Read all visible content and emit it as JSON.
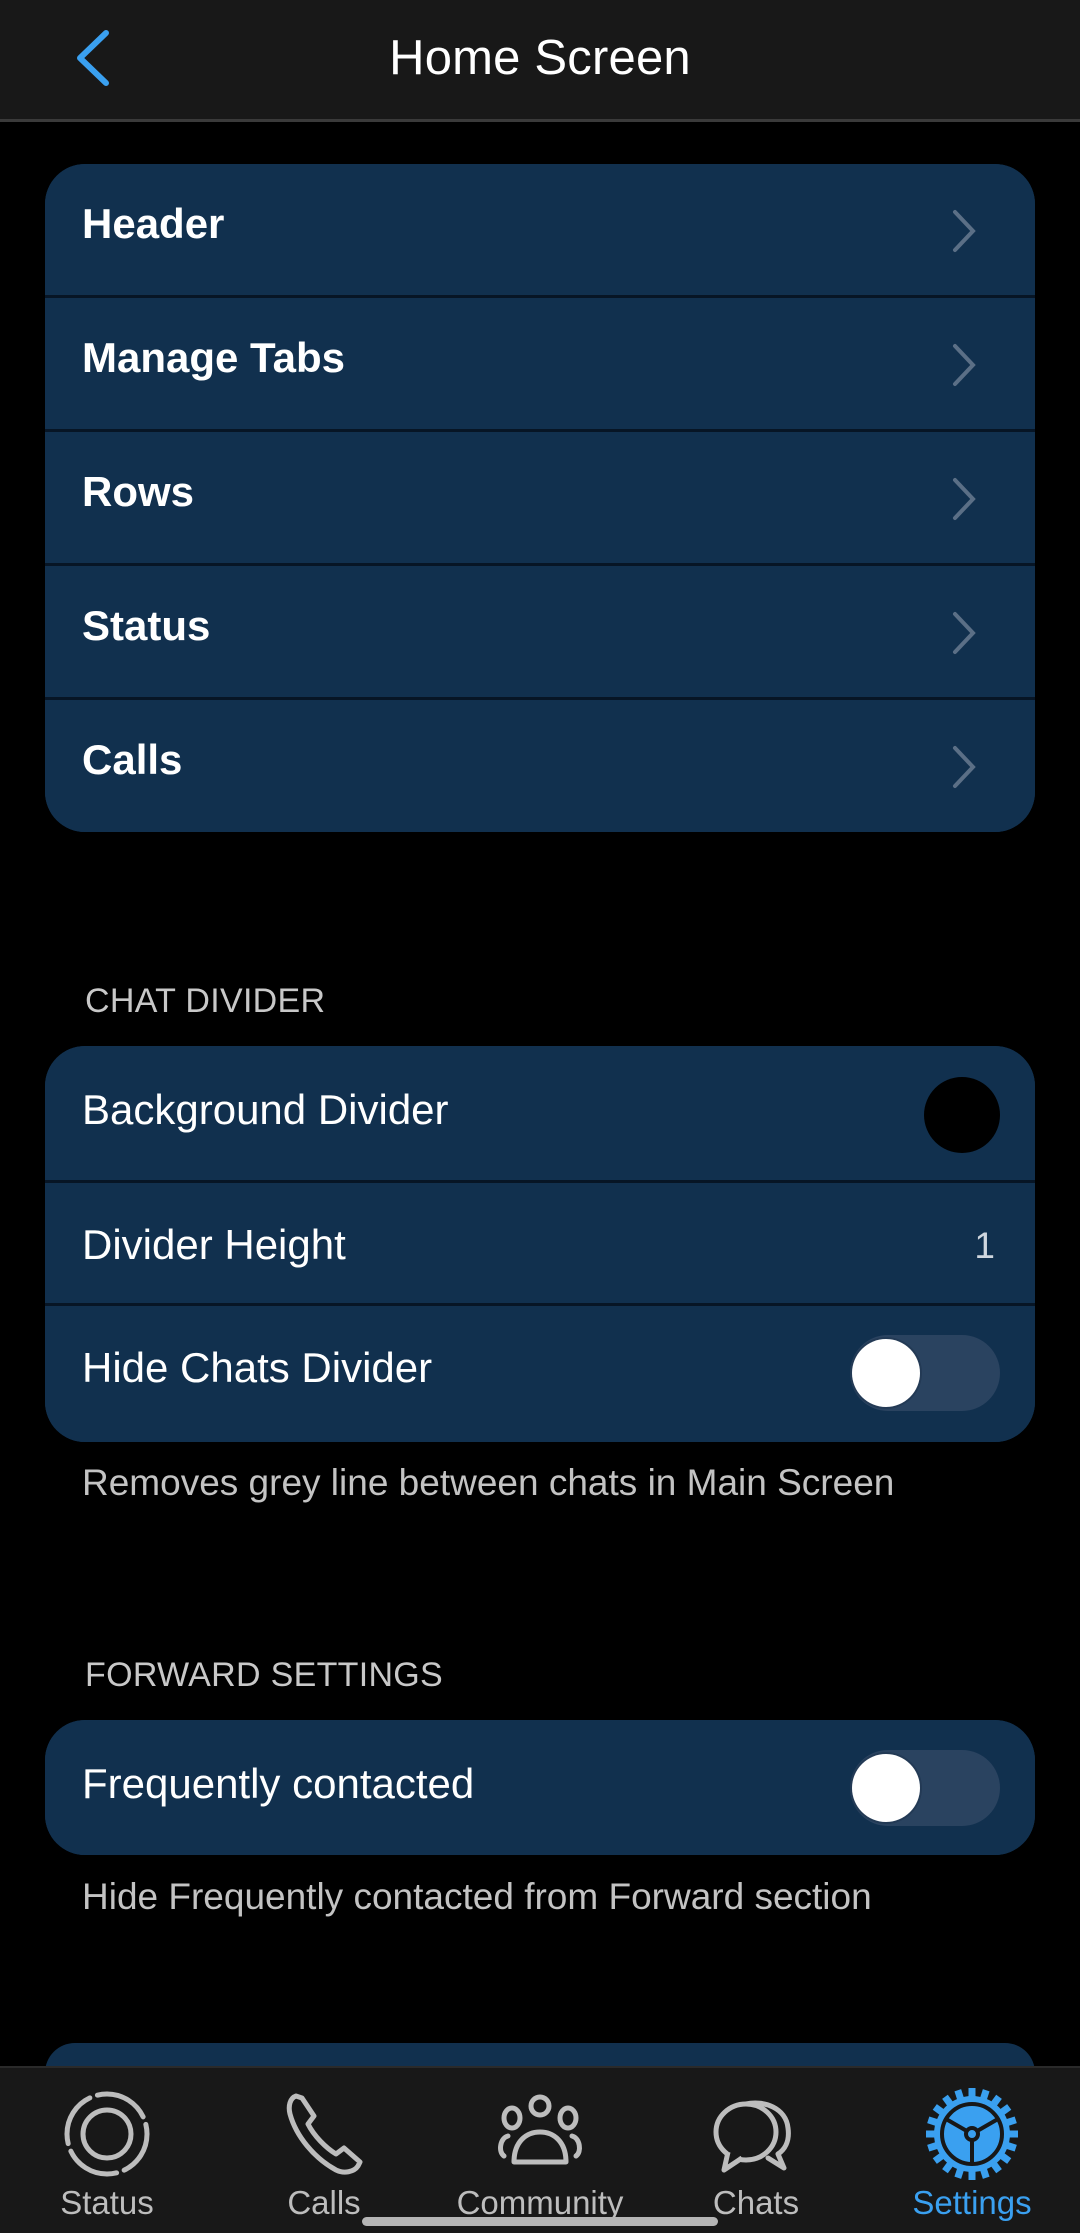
{
  "header": {
    "title": "Home Screen",
    "back_icon": "chevron-left-icon"
  },
  "nav_section": {
    "items": [
      {
        "label": "Header"
      },
      {
        "label": "Manage Tabs"
      },
      {
        "label": "Rows"
      },
      {
        "label": "Status"
      },
      {
        "label": "Calls"
      }
    ]
  },
  "chat_divider": {
    "title": "CHAT DIVIDER",
    "background_divider": {
      "label": "Background Divider",
      "color": "#000000"
    },
    "divider_height": {
      "label": "Divider Height",
      "value": "1"
    },
    "hide_chats_divider": {
      "label": "Hide Chats Divider",
      "enabled": false
    },
    "hint": "Removes grey line between chats in Main Screen"
  },
  "forward_settings": {
    "title": "FORWARD SETTINGS",
    "frequently_contacted": {
      "label": "Frequently contacted",
      "enabled": false
    },
    "hint": "Hide Frequently contacted from Forward section"
  },
  "bottom_nav": {
    "items": [
      {
        "label": "Status",
        "icon": "status-icon",
        "active": false
      },
      {
        "label": "Calls",
        "icon": "phone-icon",
        "active": false
      },
      {
        "label": "Community",
        "icon": "community-icon",
        "active": false
      },
      {
        "label": "Chats",
        "icon": "chats-icon",
        "active": false
      },
      {
        "label": "Settings",
        "icon": "gear-icon",
        "active": true
      }
    ]
  },
  "colors": {
    "accent": "#3aa0f0",
    "card": "#11304e",
    "background": "#000000",
    "bar": "#181818"
  }
}
